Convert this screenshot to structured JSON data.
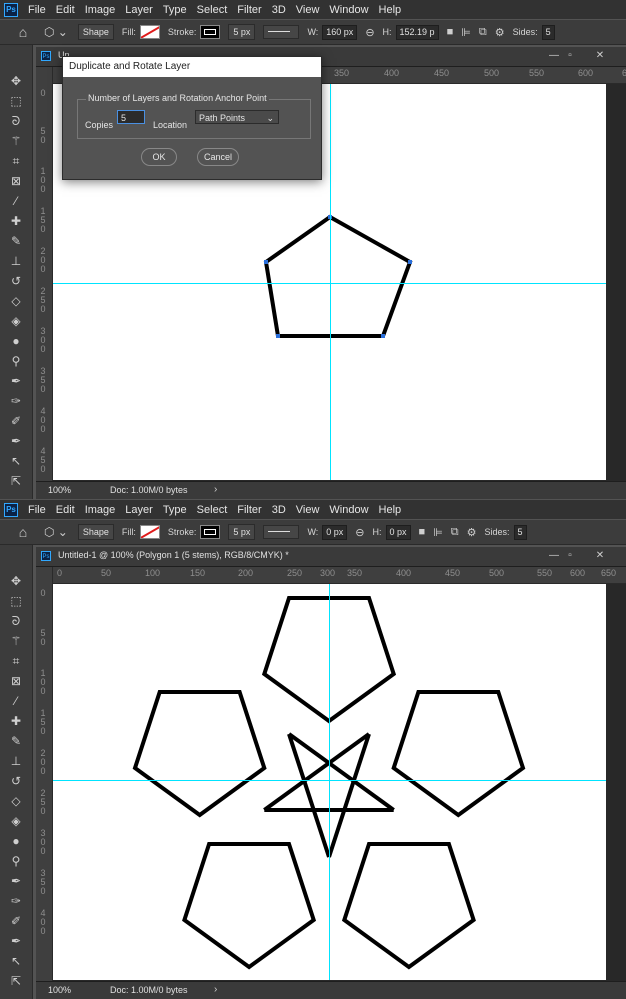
{
  "menu": [
    "File",
    "Edit",
    "Image",
    "Layer",
    "Type",
    "Select",
    "Filter",
    "3D",
    "View",
    "Window",
    "Help"
  ],
  "app_logo": "Ps",
  "options_top": {
    "tool_mode": "Shape",
    "fill_label": "Fill:",
    "stroke_label": "Stroke:",
    "stroke_width": "5 px",
    "w_label": "W:",
    "w_value": "160 px",
    "h_label": "H:",
    "h_value": "152.19 p",
    "sides_label": "Sides:",
    "sides_value": "5"
  },
  "options_bottom": {
    "tool_mode": "Shape",
    "fill_label": "Fill:",
    "stroke_label": "Stroke:",
    "stroke_width": "5 px",
    "w_label": "W:",
    "w_value": "0 px",
    "h_label": "H:",
    "h_value": "0 px",
    "sides_label": "Sides:",
    "sides_value": "5"
  },
  "top_doc": {
    "tab_prefix": "Un",
    "ruler_h": [
      "350",
      "400",
      "450",
      "500",
      "550",
      "600",
      "650"
    ],
    "ruler_v": [
      "0",
      "5 0",
      "1 0 0",
      "1 5 0",
      "2 0 0",
      "2 5 0",
      "3 0 0",
      "3 5 0",
      "4 0 0",
      "4 5 0"
    ],
    "zoom": "100%",
    "doc_size": "Doc: 1.00M/0 bytes"
  },
  "bottom_doc": {
    "tab_title": "Untitled-1 @ 100% (Polygon 1 (5 stems), RGB/8/CMYK) *",
    "ruler_h": [
      "0",
      "50",
      "100",
      "150",
      "200",
      "250",
      "300",
      "350",
      "400",
      "450",
      "500",
      "550",
      "600",
      "650"
    ],
    "ruler_v": [
      "0",
      "5 0",
      "1 0 0",
      "1 5 0",
      "2 0 0",
      "2 5 0",
      "3 0 0",
      "3 5 0",
      "4 0 0"
    ],
    "zoom": "100%",
    "doc_size": "Doc: 1.00M/0 bytes"
  },
  "dialog": {
    "title": "Duplicate and Rotate Layer",
    "group_label": "Number of Layers and Rotation Anchor Point",
    "copies_label": "Copies",
    "copies_value": "5",
    "location_label": "Location",
    "location_value": "Path Points",
    "ok_label": "OK",
    "cancel_label": "Cancel"
  }
}
